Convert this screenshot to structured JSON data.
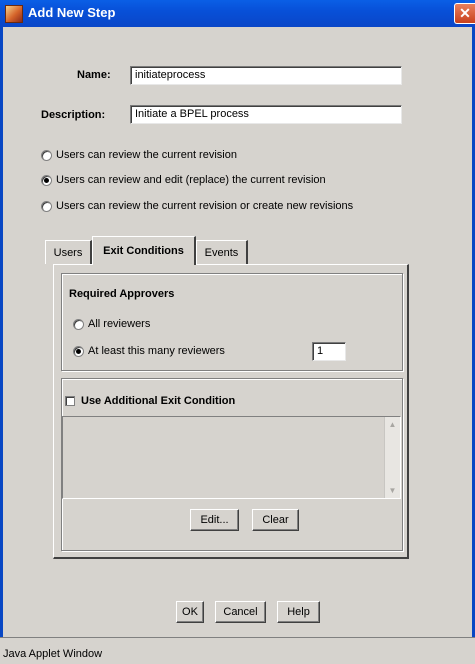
{
  "window": {
    "title": "Add New Step",
    "close_glyph": "✕"
  },
  "form": {
    "name_label": "Name:",
    "name_value": "initiateprocess",
    "description_label": "Description:",
    "description_value": "Initiate a BPEL process"
  },
  "review_options": [
    {
      "label": "Users can review the current revision",
      "selected": false
    },
    {
      "label": "Users can review and edit (replace) the current revision",
      "selected": true
    },
    {
      "label": "Users can review the current revision or create new revisions",
      "selected": false
    }
  ],
  "tabs": [
    {
      "label": "Users",
      "active": false
    },
    {
      "label": "Exit Conditions",
      "active": true
    },
    {
      "label": "Events",
      "active": false
    }
  ],
  "exit_conditions": {
    "required_approvers_title": "Required Approvers",
    "all_reviewers_label": "All reviewers",
    "at_least_label": "At least this many reviewers",
    "at_least_count": "1",
    "additional_condition_label": "Use Additional Exit Condition",
    "edit_button": "Edit...",
    "clear_button": "Clear"
  },
  "buttons": {
    "ok": "OK",
    "cancel": "Cancel",
    "help": "Help"
  },
  "status": {
    "text": "Java Applet Window"
  },
  "colors": {
    "titlebar": "#0a50d8",
    "dialog_bg": "#d6d3ce",
    "close": "#c8401c"
  }
}
